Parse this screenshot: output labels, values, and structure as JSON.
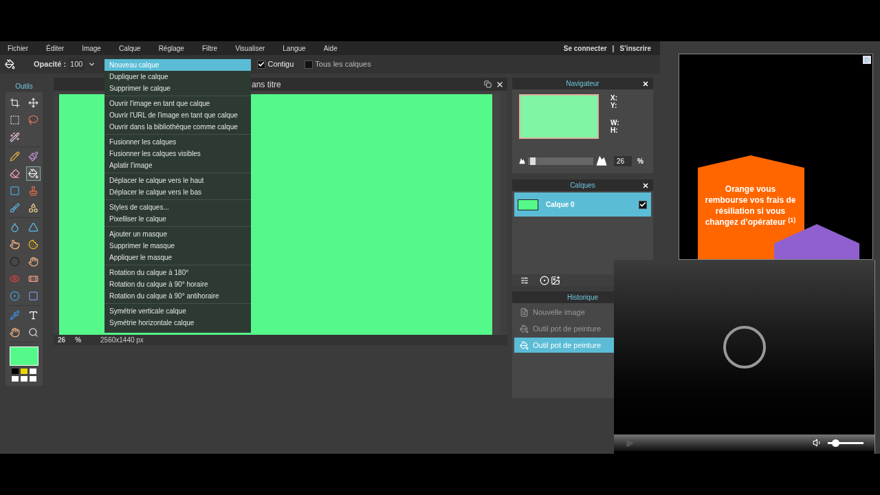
{
  "menu_bar": {
    "items": [
      "Fichier",
      "Éditer",
      "Image",
      "Calque",
      "Réglage",
      "Filtre",
      "Visualiser",
      "Langue",
      "Aide"
    ],
    "account": [
      "Se connecter",
      "|",
      "S’inscrire"
    ]
  },
  "toolbar": {
    "opacity_label": "Opacité :",
    "opacity_value": "100",
    "options": [
      {
        "label": "Contigu",
        "checked": true
      },
      {
        "label": "Tous les calques",
        "checked": false
      }
    ]
  },
  "layer_menu": {
    "groups": [
      {
        "items": [
          {
            "label": "Nouveau calque",
            "selected": true
          },
          {
            "label": "Dupliquer le calque",
            "selected": false
          },
          {
            "label": "Supprimer le calque",
            "selected": false
          }
        ]
      },
      {
        "items": [
          {
            "label": "Ouvrir l'image en tant que calque",
            "selected": false
          },
          {
            "label": "Ouvrir l'URL de l'image en tant que calque",
            "selected": false
          },
          {
            "label": "Ouvrir dans la bibliothèque comme calque",
            "selected": false
          }
        ]
      },
      {
        "items": [
          {
            "label": "Fusionner les calques",
            "selected": false
          },
          {
            "label": "Fusionner les calques visibles",
            "selected": false
          },
          {
            "label": "Aplatir l'image",
            "selected": false
          }
        ]
      },
      {
        "items": [
          {
            "label": "Déplacer le calque vers le haut",
            "selected": false
          },
          {
            "label": "Déplacer le calque vers le bas",
            "selected": false
          }
        ]
      },
      {
        "items": [
          {
            "label": "Styles de calques...",
            "selected": false
          },
          {
            "label": "Pixelliser le calque",
            "selected": false
          }
        ]
      },
      {
        "items": [
          {
            "label": "Ajouter un masque",
            "selected": false
          },
          {
            "label": "Supprimer le masque",
            "selected": false
          },
          {
            "label": "Appliquer le masque",
            "selected": false
          }
        ]
      },
      {
        "items": [
          {
            "label": "Rotation du calque à 180°",
            "selected": false
          },
          {
            "label": "Rotation du calque à 90° horaire",
            "selected": false
          },
          {
            "label": "Rotation du calque à 90° antihoraire",
            "selected": false
          }
        ]
      },
      {
        "items": [
          {
            "label": "Symétrie verticale calque",
            "selected": false
          },
          {
            "label": "Symétrie horizontale calque",
            "selected": false
          }
        ]
      }
    ]
  },
  "tools_panel": {
    "title": "Outils",
    "groups": [
      {
        "tools": [
          {
            "selected": false
          },
          {
            "selected": false
          },
          {
            "selected": false
          },
          {
            "selected": false
          },
          {
            "selected": false
          }
        ]
      },
      {
        "tools": [
          {
            "selected": false
          },
          {
            "selected": false
          },
          {
            "selected": false
          },
          {
            "selected": true
          },
          {
            "selected": false
          },
          {
            "selected": false
          },
          {
            "selected": false
          },
          {
            "selected": false
          }
        ]
      },
      {
        "tools": [
          {
            "selected": false
          },
          {
            "selected": false
          },
          {
            "selected": false
          },
          {
            "selected": false
          },
          {
            "selected": false
          },
          {
            "selected": false
          },
          {
            "selected": false
          },
          {
            "selected": false
          },
          {
            "selected": false
          },
          {
            "selected": false
          }
        ]
      },
      {
        "tools": [
          {
            "selected": false
          },
          {
            "selected": false
          },
          {
            "selected": false
          },
          {
            "selected": false
          }
        ]
      }
    ],
    "foreground": {
      "color": "#55f98a"
    },
    "swatches": [
      {
        "color": "#000000"
      },
      {
        "color": "#e8d800"
      },
      {
        "color": "#ffffff"
      },
      {
        "color": "#ffffff"
      },
      {
        "color": "#ffffff"
      },
      {
        "color": "#ffffff"
      }
    ]
  },
  "document": {
    "title": "ans titre",
    "zoom": "26",
    "zoom_unit": "%",
    "size": "2560x1440 px"
  },
  "navigator": {
    "title": "Navigateur",
    "labels": [
      "X:",
      "Y:",
      "W:",
      "H:"
    ],
    "zoom": {
      "level": 0.03,
      "value": "26",
      "unit": "%"
    }
  },
  "layers": {
    "title": "Calques",
    "items": [
      {
        "name": "Calque 0",
        "selected": true,
        "visible": true
      }
    ]
  },
  "history": {
    "title": "Historique",
    "items": [
      {
        "label": "Nouvelle image",
        "selected": false,
        "disabled": true
      },
      {
        "label": "Outil pot de peinture",
        "selected": false,
        "disabled": true
      },
      {
        "label": "Outil pot de peinture",
        "selected": true,
        "disabled": false
      }
    ]
  },
  "ad": {
    "text": "Orange vous rembourse vos frais de résiliation si vous changez d’opérateur $^{(1)}$"
  },
  "video_player": {
    "loading": true,
    "volume": {
      "level": 0.15
    }
  }
}
